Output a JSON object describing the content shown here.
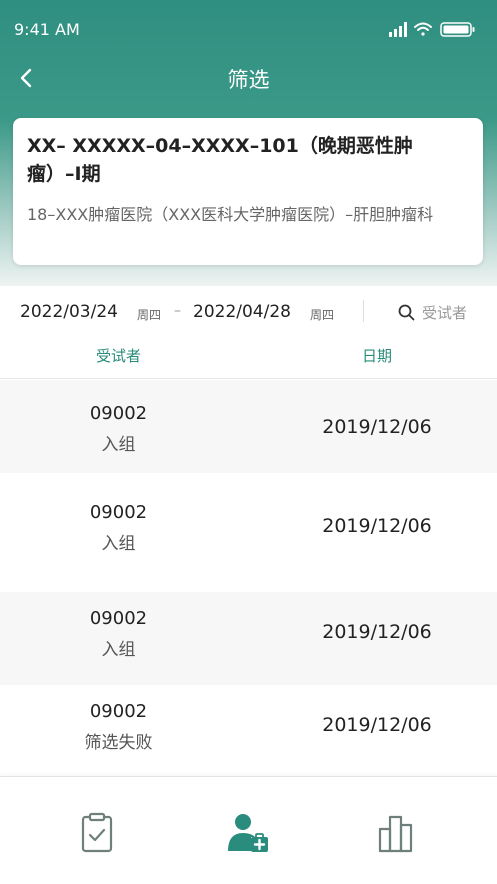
{
  "status_bar": {
    "time": "9:41 AM"
  },
  "nav": {
    "title": "筛选"
  },
  "trial": {
    "title": "XX– XXXXX–04–XXXX–101（晚期恶性肿瘤）–I期",
    "subtitle": "18–XXX肿瘤医院（XXX医科大学肿瘤医院）–肝胆肿瘤科"
  },
  "filter": {
    "start_date": "2022/03/24",
    "start_weekday": "周四",
    "separator": "–",
    "end_date": "2022/04/28",
    "end_weekday": "周四",
    "search_placeholder": "受试者"
  },
  "columns": {
    "subject": "受试者",
    "date": "日期"
  },
  "rows": [
    {
      "id": "09002",
      "status": "入组",
      "date": "2019/12/06"
    },
    {
      "id": "09002",
      "status": "入组",
      "date": "2019/12/06"
    },
    {
      "id": "09002",
      "status": "入组",
      "date": "2019/12/06"
    },
    {
      "id": "09002",
      "status": "筛选失败",
      "date": "2019/12/06"
    }
  ],
  "tabs": [
    {
      "icon": "clipboard-check-icon",
      "active": false
    },
    {
      "icon": "patient-medical-icon",
      "active": true
    },
    {
      "icon": "bar-chart-icon",
      "active": false
    }
  ],
  "colors": {
    "accent": "#2a8c7c",
    "header_start": "#2f8f80",
    "inactive_icon": "#6f7f7c"
  }
}
